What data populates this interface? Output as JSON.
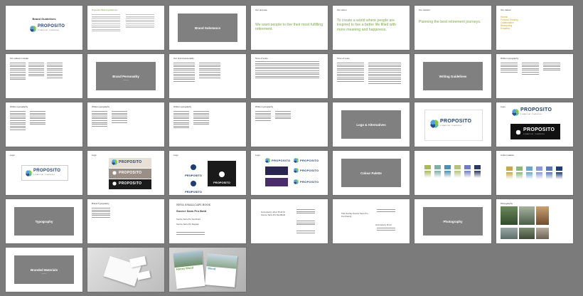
{
  "slides": {
    "s1": {
      "title": "Brand Guidelines",
      "logo": "PROPOSITO",
      "tagline": "FINANCIAL PLANNING"
    },
    "s2": {
      "heading": "Proposito Brand guidelines"
    },
    "s3": {
      "block": "Brand Substance"
    },
    "s4": {
      "heading": "Our purpose",
      "headline": "We want people to live their most fulfilling retirement."
    },
    "s5": {
      "heading": "Our vision",
      "headline": "To create a world where people are inspired to live a better life filled with more meaning and happiness."
    },
    "s6": {
      "heading": "Our mission",
      "headline": "Planning the best retirement journeys."
    },
    "s7": {
      "heading": "Our values",
      "values": [
        "Honest",
        "Forward Thinking",
        "Collaborative",
        "Reassuring",
        "Empathic"
      ]
    },
    "s8": {
      "heading": "Our values in detail"
    },
    "s9": {
      "block": "Brand Personality"
    },
    "s10": {
      "heading": "Our brand personality"
    },
    "s11": {
      "heading": "Tone of voice"
    },
    "s12": {
      "heading": "Tone of voice"
    },
    "s13": {
      "block": "Writing Guidelines"
    },
    "s14": {
      "heading": "Written typography"
    },
    "s15": {
      "heading": "Written typography"
    },
    "s16": {
      "heading": "Written typography"
    },
    "s17": {
      "heading": "Written typography"
    },
    "s18": {
      "heading": "Written typography"
    },
    "s19": {
      "block": "Logo & Alternatives"
    },
    "s20": {
      "logo": "PROPOSITO",
      "tagline": "FINANCIAL PLANNING"
    },
    "s21": {
      "heading": "Logo",
      "logo": "PROPOSITO",
      "tagline": "FINANCIAL PLANNING"
    },
    "s22": {
      "heading": "Logo",
      "logo": "PROPOSITO",
      "tagline": "FINANCIAL PLANNING"
    },
    "s23": {
      "heading": "Logo",
      "logo": "PROPOSITO"
    },
    "s24": {
      "heading": "Logo",
      "logo": "PROPOSITO"
    },
    "s25": {
      "heading": "Logo"
    },
    "s26": {
      "block": "Colour Palette"
    },
    "s27": {
      "swatches": [
        "#a9b95a",
        "#7eb0a5",
        "#4d8fb0",
        "#b3c37b",
        "#6e7ec6",
        "#2a3a5e"
      ]
    },
    "s28": {
      "heading": "Colour palette",
      "swatches": [
        "#c8a84a",
        "#8fb77a",
        "#6aa6c9",
        "#8a9ad6",
        "#5a78b8",
        "#1f3d73"
      ]
    },
    "s29": {
      "block": "Typography"
    },
    "s30": {
      "heading": "Brand Typography"
    },
    "s31": {
      "line1": "NEVA SMALLCAPS BOOK",
      "line2": "Source Sans Pro Bold",
      "line3": "Source Sans Pro Semibold",
      "line4": "Source Sans Pro Regular"
    },
    "s32": {
      "line1": "Gutenberg Alter Bold In",
      "line2": "Source Sans Pro SemiBold"
    },
    "s33": {
      "line1": "Title Overlay Source Sans Pro",
      "line2": "Font Family",
      "line3": "Gutenberg Bold"
    },
    "s34": {
      "block": "Photography"
    },
    "s35": {
      "heading": "Photography"
    },
    "s36": {
      "block": "Branded Materials"
    },
    "s37": {},
    "s38": {
      "brochure_title": "Honey Wood",
      "brochure_tag": "Wood"
    }
  },
  "colors": {
    "slide_bg": "#ffffff",
    "page_bg": "#7b7b7b",
    "grey_block": "#808080",
    "accent_green": "#7aa844",
    "navy": "#1f3d73",
    "values_gold": "#c9a227"
  }
}
